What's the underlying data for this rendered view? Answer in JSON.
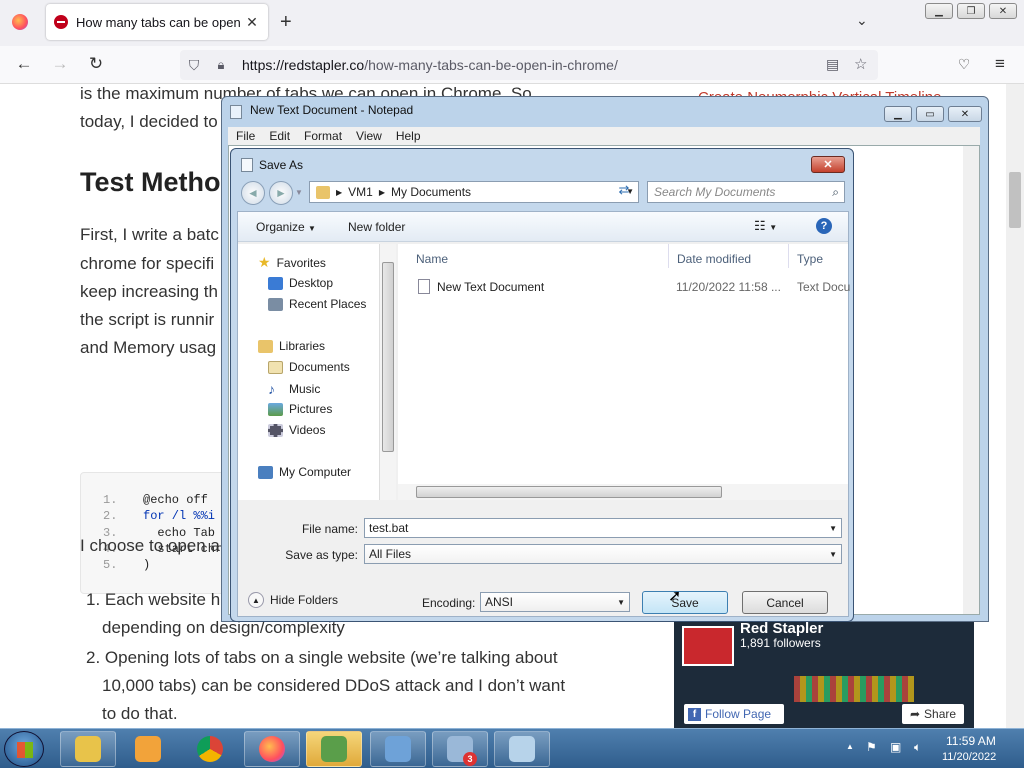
{
  "browser": {
    "tab_title": "How many tabs can be open in",
    "url_host": "https://redstapler.co",
    "url_path": "/how-many-tabs-can-be-open-in-chrome/"
  },
  "page": {
    "para1_a": "is the maximum number of tabs we can open in Chrome. So",
    "para1_b": "today, I decided to",
    "heading": "Test Metho",
    "para2": [
      "First, I write a batc",
      "chrome for specifi",
      "keep increasing th",
      "the script is runnir",
      "and Memory usag"
    ],
    "code": [
      {
        "n": "1.",
        "t": "@echo off"
      },
      {
        "n": "2.",
        "t": "for /l %%i"
      },
      {
        "n": "3.",
        "t": "  echo Tab"
      },
      {
        "n": "4.",
        "t": "  start chr"
      },
      {
        "n": "5.",
        "t": ")"
      }
    ],
    "para3": "I choose to open a",
    "li1_a": "1. Each website ha",
    "li1_b": "depending on design/complexity",
    "li2_a": "2. Opening lots of tabs on a single website (we’re talking about",
    "li2_b": "10,000 tabs) can be considered DDoS attack and I don’t want",
    "li2_c": "to do that.",
    "side_link": "Create Neumorphic Vertical Timeline",
    "fb_name": "Red Stapler",
    "fb_followers": "1,891 followers",
    "fb_follow": "Follow Page",
    "fb_share": "Share"
  },
  "notepad": {
    "title": "New Text Document - Notepad",
    "menu": [
      "File",
      "Edit",
      "Format",
      "View",
      "Help"
    ]
  },
  "saveas": {
    "title": "Save As",
    "crumbs": [
      "VM1",
      "My Documents"
    ],
    "search_placeholder": "Search My Documents",
    "organize": "Organize",
    "new_folder": "New folder",
    "nav": {
      "favorites": "Favorites",
      "desktop": "Desktop",
      "recent": "Recent Places",
      "libraries": "Libraries",
      "documents": "Documents",
      "music": "Music",
      "pictures": "Pictures",
      "videos": "Videos",
      "computer": "My Computer"
    },
    "columns": {
      "name": "Name",
      "date": "Date modified",
      "type": "Type"
    },
    "file": {
      "name": "New Text Document",
      "date": "11/20/2022 11:58 ...",
      "type": "Text Docu"
    },
    "file_name_label": "File name:",
    "file_name_value": "test.bat",
    "save_type_label": "Save as type:",
    "save_type_value": "All Files",
    "hide_folders": "Hide Folders",
    "encoding_label": "Encoding:",
    "encoding_value": "ANSI",
    "save_button": "Save",
    "cancel_button": "Cancel"
  },
  "taskbar": {
    "badge": "3",
    "time": "11:59 AM",
    "date": "11/20/2022"
  },
  "colors": {
    "accent": "#1a73e8",
    "link_red": "#c0392b"
  }
}
